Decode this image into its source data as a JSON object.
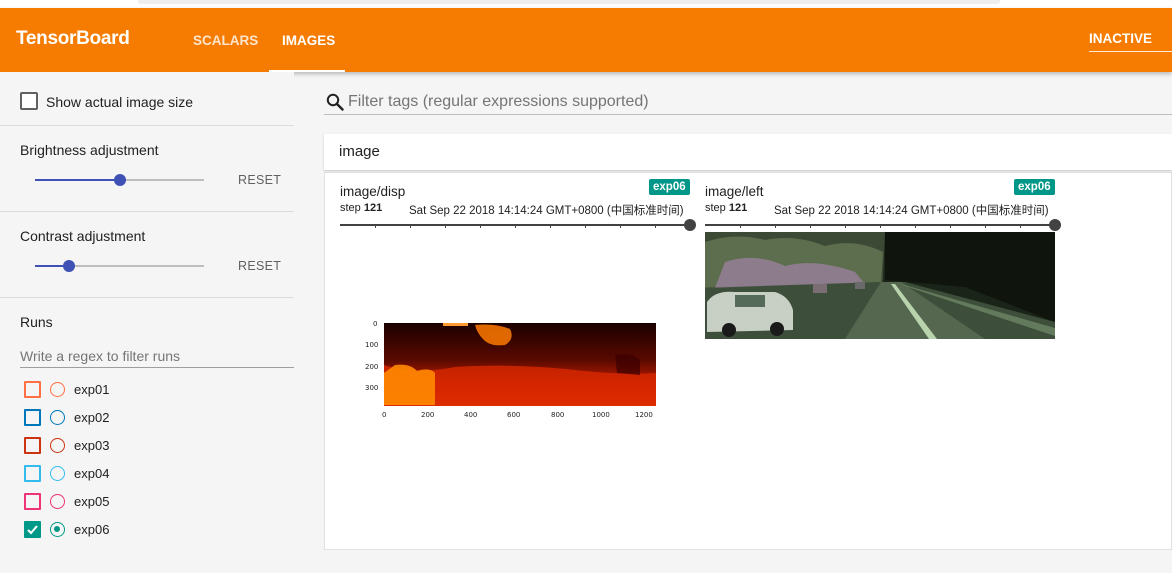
{
  "app": {
    "title": "TensorBoard",
    "tabs": [
      {
        "label": "SCALARS",
        "active": false
      },
      {
        "label": "IMAGES",
        "active": true
      }
    ],
    "status": "INACTIVE",
    "accent_color": "#f57c00"
  },
  "sidebar": {
    "show_actual_size_label": "Show actual image size",
    "show_actual_size_checked": false,
    "brightness": {
      "label": "Brightness adjustment",
      "reset": "RESET",
      "level": 0.5
    },
    "contrast": {
      "label": "Contrast adjustment",
      "reset": "RESET",
      "level": 0.2
    },
    "runs": {
      "title": "Runs",
      "placeholder": "Write a regex to filter runs",
      "items": [
        {
          "name": "exp01",
          "color": "#ff7043",
          "checked": false
        },
        {
          "name": "exp02",
          "color": "#0077bb",
          "checked": false
        },
        {
          "name": "exp03",
          "color": "#cc3311",
          "checked": false
        },
        {
          "name": "exp04",
          "color": "#33bbee",
          "checked": false
        },
        {
          "name": "exp05",
          "color": "#ee3377",
          "checked": false
        },
        {
          "name": "exp06",
          "color": "#009988",
          "checked": true
        }
      ]
    }
  },
  "main": {
    "filter_placeholder": "Filter tags (regular expressions supported)",
    "category": "image",
    "cards": [
      {
        "tag": "image/disp",
        "run": "exp06",
        "step_label": "step",
        "step": "121",
        "timestamp": "Sat Sep 22 2018 14:14:24 GMT+0800 (中国标准时间)",
        "plot": {
          "y_ticks": [
            "0",
            "100",
            "200",
            "300"
          ],
          "x_ticks": [
            "0",
            "200",
            "400",
            "600",
            "800",
            "1000",
            "1200"
          ]
        }
      },
      {
        "tag": "image/left",
        "run": "exp06",
        "step_label": "step",
        "step": "121",
        "timestamp": "Sat Sep 22 2018 14:14:24 GMT+0800 (中国标准时间)"
      }
    ]
  }
}
